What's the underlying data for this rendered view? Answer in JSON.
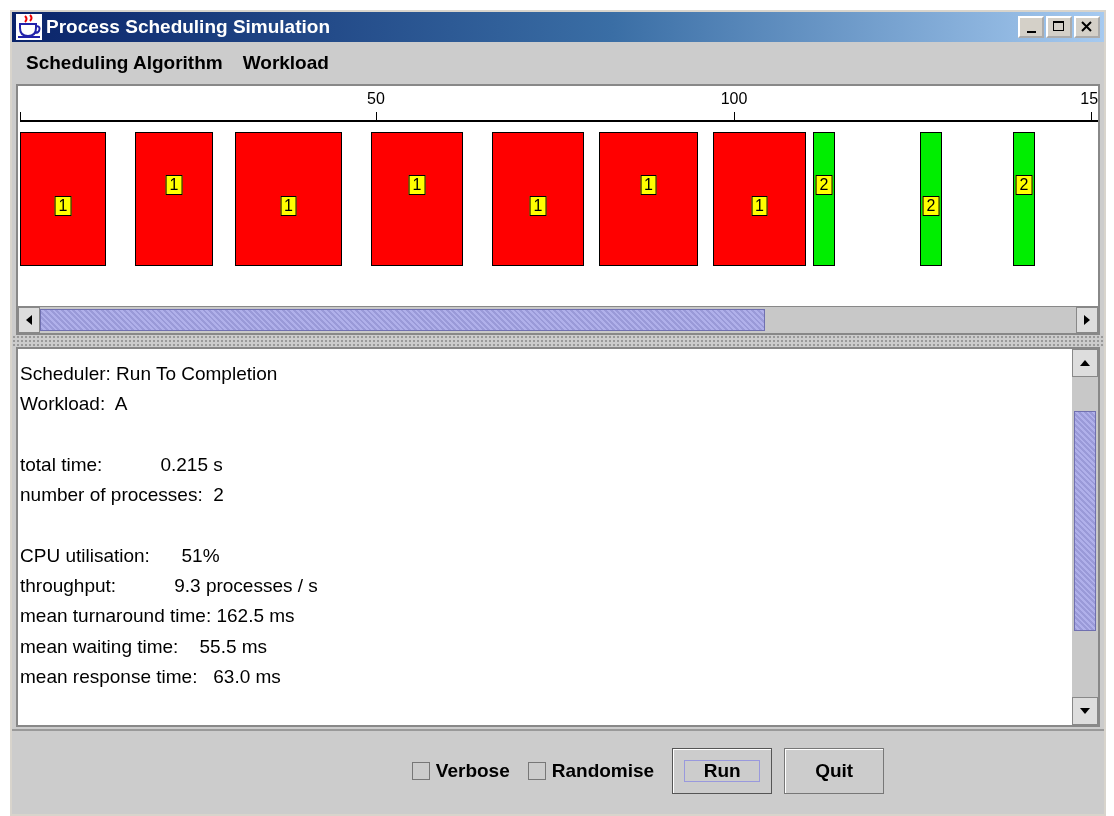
{
  "window": {
    "title": "Process Scheduling Simulation"
  },
  "menu": [
    "Scheduling Algorithm",
    "Workload"
  ],
  "timeline": {
    "tick_labels": [
      "50",
      "100",
      "15"
    ],
    "bursts": [
      {
        "process": "1",
        "color": "#ff0000"
      },
      {
        "process": "1",
        "color": "#ff0000"
      },
      {
        "process": "1",
        "color": "#ff0000"
      },
      {
        "process": "1",
        "color": "#ff0000"
      },
      {
        "process": "1",
        "color": "#ff0000"
      },
      {
        "process": "1",
        "color": "#ff0000"
      },
      {
        "process": "1",
        "color": "#ff0000"
      },
      {
        "process": "2",
        "color": "#00ee00"
      },
      {
        "process": "2",
        "color": "#00ee00"
      },
      {
        "process": "2",
        "color": "#00ee00"
      }
    ]
  },
  "report": [
    [
      "Scheduler: Run To Completion",
      "Workload:  A"
    ],
    [
      "total time:           0.215 s",
      "number of processes:  2"
    ],
    [
      "CPU utilisation:      51%",
      "throughput:           9.3 processes / s",
      "mean turnaround time: 162.5 ms",
      "mean waiting time:    55.5 ms",
      "mean response time:   63.0 ms"
    ]
  ],
  "options": [
    {
      "label": "Verbose",
      "checked": false
    },
    {
      "label": "Randomise",
      "checked": false
    }
  ],
  "buttons": [
    {
      "label": "Run",
      "focused": true
    },
    {
      "label": "Quit",
      "focused": false
    }
  ]
}
